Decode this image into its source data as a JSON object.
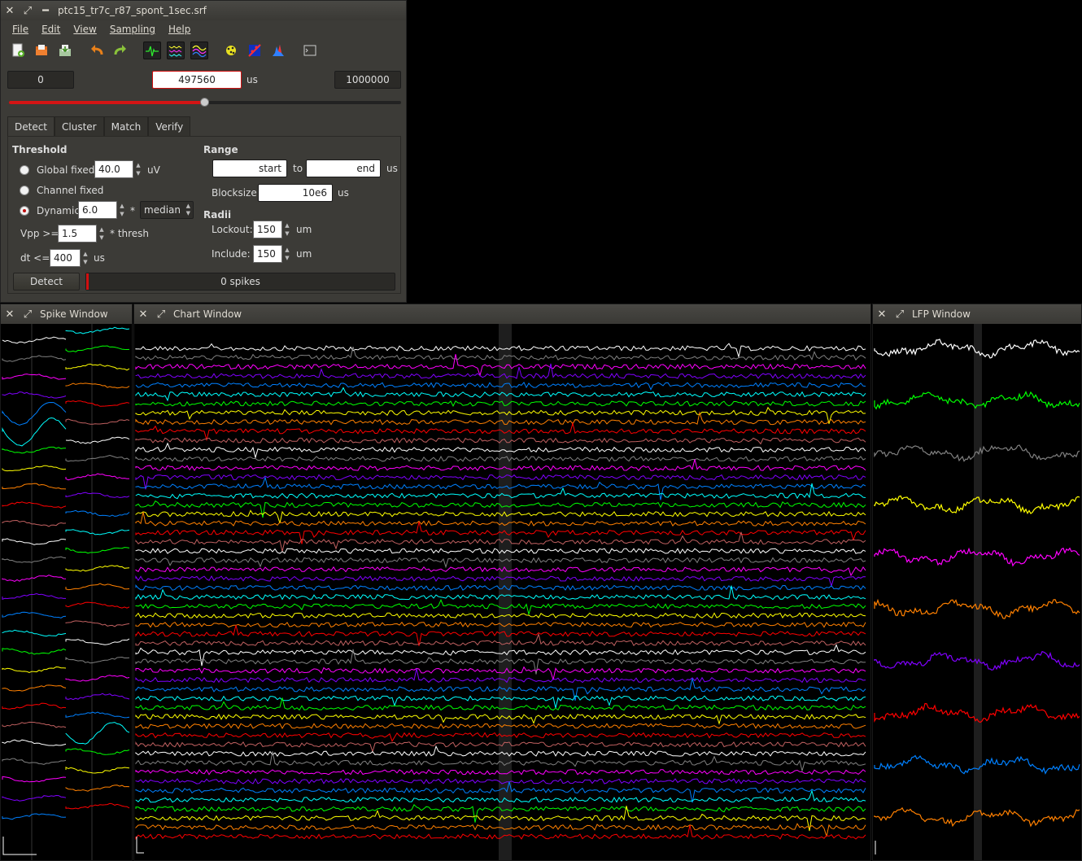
{
  "main_window": {
    "title": "ptc15_tr7c_r87_spont_1sec.srf",
    "menu": [
      "File",
      "Edit",
      "View",
      "Sampling",
      "Help"
    ],
    "toolbar_icons": [
      "new-file-icon",
      "open-file-icon",
      "save-file-icon",
      "undo-icon",
      "redo-icon",
      "spike-window-icon",
      "chart-window-icon",
      "lfp-window-icon",
      "cluster-icon",
      "plot-icon",
      "histogram-icon",
      "shell-icon"
    ]
  },
  "time": {
    "start": "0",
    "current": "497560",
    "end": "1000000",
    "unit": "us",
    "position": 0.4976
  },
  "tabs": [
    "Detect",
    "Cluster",
    "Match",
    "Verify"
  ],
  "detect": {
    "threshold_title": "Threshold",
    "global_fixed_label": "Global fixed",
    "global_fixed_value": "40.0",
    "global_fixed_unit": "uV",
    "channel_fixed_label": "Channel fixed",
    "dynamic_label": "Dynamic",
    "dynamic_value": "6.0",
    "dynamic_mult": "*",
    "dynamic_method": "median",
    "vpp_label": "Vpp >=",
    "vpp_value": "1.5",
    "vpp_suffix": "* thresh",
    "dt_label": "dt <=",
    "dt_value": "400",
    "dt_unit": "us",
    "range_title": "Range",
    "range_start": "start",
    "range_to": "to",
    "range_end": "end",
    "range_unit": "us",
    "blocksize_label": "Blocksize:",
    "blocksize_value": "10e6",
    "blocksize_unit": "us",
    "radii_title": "Radii",
    "lockout_label": "Lockout:",
    "lockout_value": "150",
    "lockout_unit": "um",
    "include_label": "Include:",
    "include_value": "150",
    "include_unit": "um",
    "detect_button": "Detect",
    "spike_count": "0 spikes"
  },
  "windows": {
    "spike": {
      "title": "Spike Window"
    },
    "chart": {
      "title": "Chart Window"
    },
    "lfp": {
      "title": "LFP Window"
    }
  },
  "colors": {
    "channel_cycle": [
      "#ffffff",
      "#808080",
      "#ff00ff",
      "#8000ff",
      "#0080ff",
      "#00ffff",
      "#00ff00",
      "#ffff00",
      "#ff8000",
      "#ff0000",
      "#c06060"
    ],
    "lfp_cycle": [
      "#ffffff",
      "#00ff00",
      "#808080",
      "#ffff00",
      "#ff00ff",
      "#ff8000",
      "#8000ff",
      "#ff0000",
      "#0080ff",
      "#ff8000"
    ],
    "accent_red": "#d01010"
  }
}
